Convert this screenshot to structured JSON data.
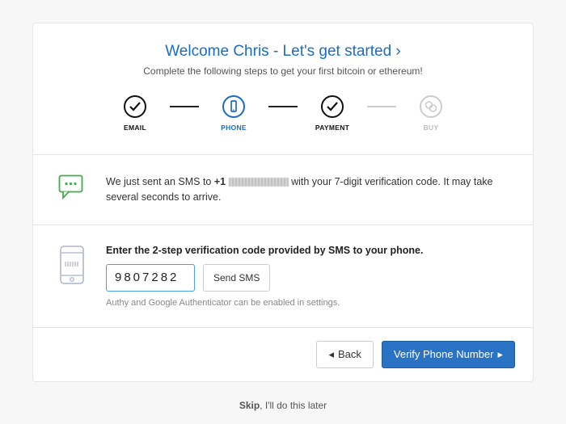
{
  "header": {
    "title": "Welcome Chris - Let's get started ›",
    "subtitle": "Complete the following steps to get your first bitcoin or ethereum!"
  },
  "steps": {
    "email": "EMAIL",
    "phone": "PHONE",
    "payment": "PAYMENT",
    "buy": "BUY"
  },
  "sms_notice": {
    "prefix": "We just sent an SMS to ",
    "phone_prefix": "+1",
    "suffix": " with your 7-digit verification code. It may take several seconds to arrive."
  },
  "verify": {
    "title": "Enter the 2-step verification code provided by SMS to your phone.",
    "code_value": "9807282",
    "send_sms_label": "Send SMS",
    "hint": "Authy and Google Authenticator can be enabled in settings."
  },
  "actions": {
    "back": "Back",
    "verify": "Verify Phone Number"
  },
  "skip": {
    "bold": "Skip",
    "rest": ", I'll do this later"
  }
}
